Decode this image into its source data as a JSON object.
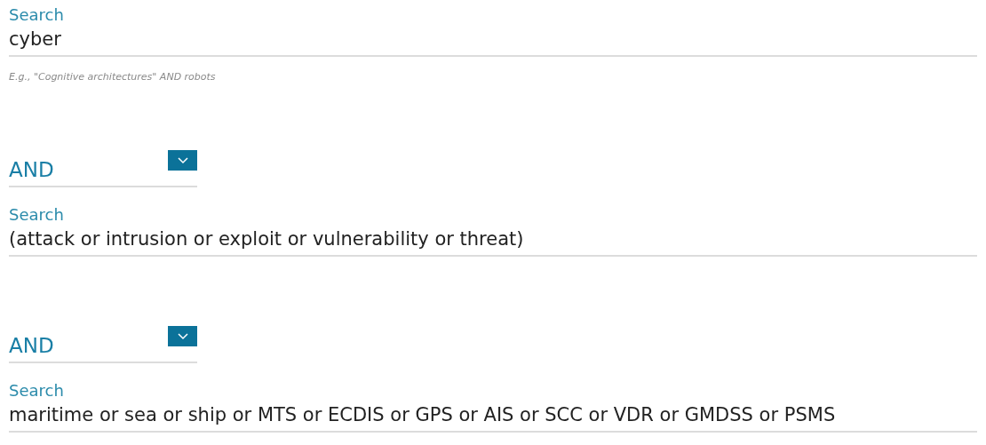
{
  "rows": [
    {
      "kind": "search",
      "label": "Search",
      "value": "cyber",
      "hint": "E.g., \"Cognitive architectures\" AND robots"
    },
    {
      "kind": "operator",
      "value": "AND"
    },
    {
      "kind": "search",
      "label": "Search",
      "value": "(attack or intrusion or exploit or vulnerability or threat)"
    },
    {
      "kind": "operator",
      "value": "AND"
    },
    {
      "kind": "search",
      "label": "Search",
      "value": "maritime or sea or ship or MTS or ECDIS or GPS or AIS or SCC or VDR or GMDSS or PSMS"
    }
  ]
}
